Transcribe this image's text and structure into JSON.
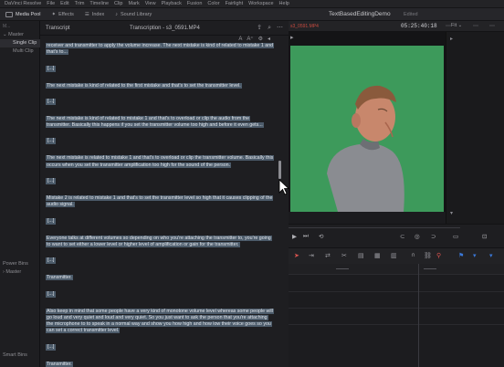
{
  "menubar": {
    "items": [
      "DaVinci Resolve",
      "File",
      "Edit",
      "Trim",
      "Timeline",
      "Clip",
      "Mark",
      "View",
      "Playback",
      "Fusion",
      "Color",
      "Fairlight",
      "Workspace",
      "Help"
    ]
  },
  "toolbar": {
    "buttons": [
      "Media Pool",
      "Effects",
      "Index",
      "Sound Library"
    ],
    "project_title": "TextBasedEditingDemo",
    "status": "Edited"
  },
  "left_panel": {
    "top_label": "M...",
    "bins": [
      "Master",
      "Single Clip",
      "Multi Clip"
    ],
    "power_bins_label": "Power Bins",
    "power_master": "Master",
    "smart_bins_label": "Smart Bins"
  },
  "transcript": {
    "title": "Transcript",
    "file": "Transcription - s3_0591.MP4",
    "segments": [
      {
        "type": "text",
        "text": "receiver and transmitter to apply the volume increase. The next mistake is kind of related to mistake 1 and that's to..."
      },
      {
        "type": "pause",
        "text": "[...]"
      },
      {
        "type": "text",
        "text": "The next mistake is kind of related to the first mistake and that's to set the transmitter level."
      },
      {
        "type": "pause",
        "text": "[...]"
      },
      {
        "type": "text",
        "text": "The next mistake is kind of related to mistake 1 and that's to overload or clip the audio from the transmitter. Basically this happens if you set the transmitter volume too high and before it even gets..."
      },
      {
        "type": "pause",
        "text": "[...]"
      },
      {
        "type": "text",
        "text": "The next mistake is related to mistake 1 and that's to overload or clip the transmitter volume. Basically this occurs when you set the transmitter amplification too high for the sound of the person."
      },
      {
        "type": "pause",
        "text": "[...]"
      },
      {
        "type": "text",
        "text": "Mistake 2 is related to mistake 1 and that's to set the transmitter level so high that it causes clipping of the audio signal."
      },
      {
        "type": "pause",
        "text": "[...]"
      },
      {
        "type": "text",
        "text": "Everyone talks at different volumes so depending on who you're attaching the transmitter to, you're going to want to set either a lower level or higher level of amplification or gain for the transmitter."
      },
      {
        "type": "pause",
        "text": "[...]"
      },
      {
        "type": "text",
        "text": "Transmitter."
      },
      {
        "type": "pause",
        "text": "[...]"
      },
      {
        "type": "text",
        "text": "Also keep in mind that some people have a very kind of monotone volume level whereas some people will go loud and very quiet and loud and very quiet. So you just want to ask the person that you're attaching the microphone to to speak in a normal way and show you how high and how low their voice goes so you can set a correct transmitter level."
      },
      {
        "type": "pause",
        "text": "[...]"
      },
      {
        "type": "text",
        "text": "Transmitter."
      }
    ]
  },
  "viewer": {
    "clip_name": "s3_0591.MP4",
    "timecode": "05:25:40:18",
    "fit_label": "Fit"
  },
  "icons": {
    "transcript": [
      "export-icon",
      "search-icon",
      "text-size-icon",
      "menu-icon"
    ],
    "transport": [
      "play-icon",
      "next-icon",
      "loop-icon"
    ]
  }
}
